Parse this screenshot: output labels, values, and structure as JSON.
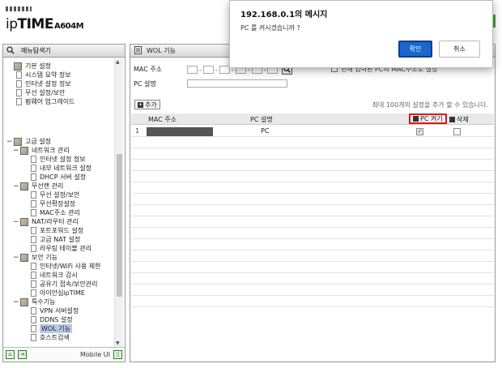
{
  "header": {
    "logo_prefix": "ip",
    "logo_brand": "TIME",
    "logo_model": "A604M"
  },
  "sidebar": {
    "title": "메뉴탐색기",
    "items": [
      {
        "label": "기본 설정",
        "type": "group",
        "toggle": ""
      },
      {
        "label": "시스템 요약 정보",
        "type": "item"
      },
      {
        "label": "인터넷 설정 정보",
        "type": "item"
      },
      {
        "label": "무선 설정/보안",
        "type": "item"
      },
      {
        "label": "펌웨어 업그레이드",
        "type": "item"
      },
      {
        "label": "고급 설정",
        "type": "group",
        "toggle": "−"
      },
      {
        "label": "네트워크 관리",
        "type": "sub",
        "toggle": "−"
      },
      {
        "label": "인터넷 설정 정보",
        "type": "leaf"
      },
      {
        "label": "내부 네트워크 설정",
        "type": "leaf"
      },
      {
        "label": "DHCP 서버 설정",
        "type": "leaf"
      },
      {
        "label": "무선랜 관리",
        "type": "sub",
        "toggle": "−"
      },
      {
        "label": "무선 설정/보안",
        "type": "leaf"
      },
      {
        "label": "무선확장설정",
        "type": "leaf"
      },
      {
        "label": "MAC주소 관리",
        "type": "leaf"
      },
      {
        "label": "NAT/라우터 관리",
        "type": "sub",
        "toggle": "−"
      },
      {
        "label": "포트포워드 설정",
        "type": "leaf"
      },
      {
        "label": "고급 NAT 설정",
        "type": "leaf"
      },
      {
        "label": "라우팅 테이블 관리",
        "type": "leaf"
      },
      {
        "label": "보안 기능",
        "type": "sub",
        "toggle": "−"
      },
      {
        "label": "인터넷/WiFi 사용 제한",
        "type": "leaf"
      },
      {
        "label": "네트워크 감시",
        "type": "leaf"
      },
      {
        "label": "공유기 접속/보안관리",
        "type": "leaf"
      },
      {
        "label": "아이안심ipTIME",
        "type": "leaf"
      },
      {
        "label": "특수기능",
        "type": "sub",
        "toggle": "−"
      },
      {
        "label": "VPN 서버설정",
        "type": "leaf"
      },
      {
        "label": "DDNS 설정",
        "type": "leaf"
      },
      {
        "label": "WOL 기능",
        "type": "leaf",
        "selected": true
      },
      {
        "label": "호스트검색",
        "type": "leaf"
      }
    ],
    "footer_label": "Mobile UI"
  },
  "main": {
    "title": "WOL 기능",
    "mac_label": "MAC 주소",
    "pc_label": "PC 설명",
    "partial_text": "현재 입력된 PC의 MAC주소로 설정",
    "add_label": "추가",
    "limit_text": "최대 100개의 설정을 추가 할 수 있습니다.",
    "columns": {
      "mac": "MAC 주소",
      "pc": "PC 설명",
      "power": "PC 켜기",
      "delete": "삭제"
    },
    "rows": [
      {
        "index": "1",
        "pc": "PC",
        "power_checked": true,
        "delete_checked": false
      }
    ]
  },
  "dialog": {
    "title": "192.168.0.1의 메시지",
    "message": "PC 를 켜시겠습니까 ?",
    "ok_label": "확인",
    "cancel_label": "취소"
  }
}
